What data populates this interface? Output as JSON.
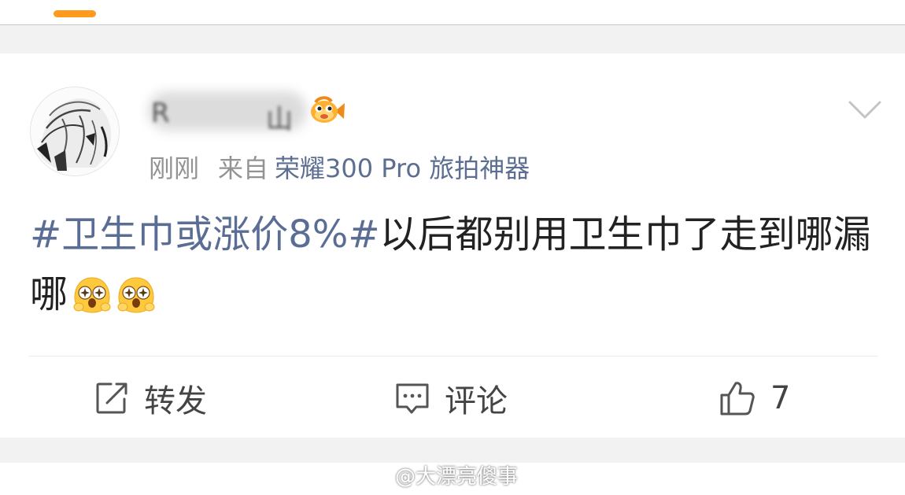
{
  "post": {
    "meta": {
      "time": "刚刚",
      "source_prefix": "来自",
      "source_device": "荣耀300 Pro 旅拍神器"
    },
    "topic": "#卫生巾或涨价8%#",
    "text": "以后都别用卫生巾了走到哪漏哪"
  },
  "actions": {
    "repost_label": "转发",
    "comment_label": "评论",
    "like_count": "7"
  },
  "watermark": {
    "text": "@大漂亮傻事"
  },
  "colors": {
    "accent": "#ff9a1f",
    "topic": "#5a6d95",
    "source": "#5d6f91",
    "meta": "#939393"
  }
}
